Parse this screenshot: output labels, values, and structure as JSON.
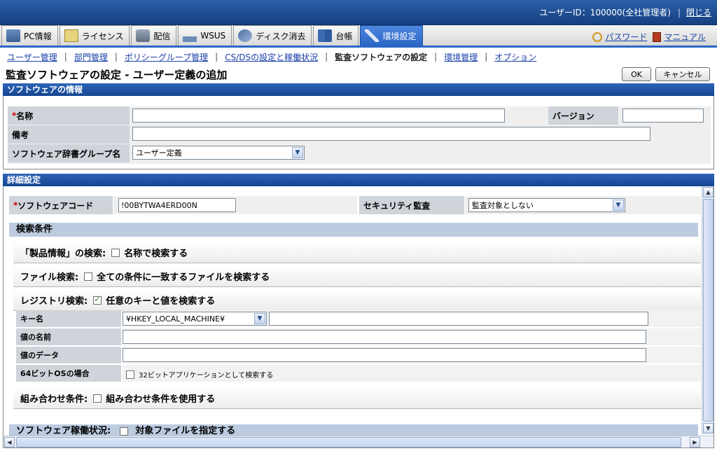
{
  "header": {
    "user_id": "ユーザーID：100000(全社管理者)",
    "sep": "|",
    "logout": "閉じる"
  },
  "tabs": [
    {
      "label": "PC情報",
      "icon": "pc-icon"
    },
    {
      "label": "ライセンス",
      "icon": "license-icon"
    },
    {
      "label": "配信",
      "icon": "distribution-icon"
    },
    {
      "label": "WSUS",
      "icon": "wsus-icon"
    },
    {
      "label": "ディスク消去",
      "icon": "disk-erase-icon"
    },
    {
      "label": "台帳",
      "icon": "ledger-icon"
    },
    {
      "label": "環境設定",
      "icon": "settings-tools-icon"
    }
  ],
  "toplinks": {
    "password": "パスワード",
    "manual": "マニュアル"
  },
  "subnav": {
    "user_mgmt": "ユーザー管理",
    "dept_mgmt": "部門管理",
    "policy_group": "ポリシーグループ管理",
    "cs_ds": "CS/DSの設定と稼働状況",
    "audit_sw": "監査ソフトウェアの設定",
    "env_mgmt": "環境管理",
    "option": "オプション",
    "bar": "|"
  },
  "page": {
    "title": "監査ソフトウェアの設定 - ユーザー定義の追加",
    "ok": "OK",
    "cancel": "キャンセル"
  },
  "software_info": {
    "heading": "ソフトウェアの情報",
    "req_mark": "*",
    "name_label": "名称",
    "name_value": "",
    "version_label": "バージョン",
    "version_value": "",
    "note_label": "備考",
    "note_value": "",
    "dict_group_label": "ソフトウェア辞書グループ名",
    "dict_group_value": "ユーザー定義"
  },
  "detail": {
    "heading": "詳細設定",
    "req_mark": "*",
    "sw_code_label": "ソフトウェアコード",
    "sw_code_value": "!00BYTWA4ERD00N",
    "security_label": "セキュリティ監査",
    "security_value": "監査対象としない",
    "search_cond": "検索条件",
    "product_search_label": "「製品情報」の検索:",
    "product_search_cb": "名称で検索する",
    "product_search_checked": false,
    "file_search_label": "ファイル検索:",
    "file_search_cb": "全ての条件に一致するファイルを検索する",
    "file_search_checked": false,
    "registry_label": "レジストリ検索:",
    "registry_cb": "任意のキーと値を検索する",
    "registry_checked": true,
    "key_name_label": "キー名",
    "key_root_value": "¥HKEY_LOCAL_MACHINE¥",
    "key_path_value": "",
    "value_name_label": "値の名前",
    "value_name_value": "",
    "value_data_label": "値のデータ",
    "value_data_value": "",
    "os64_label": "64ビットOSの場合",
    "os64_cb": "32ビットアプリケーションとして検索する",
    "os64_checked": false,
    "combo_label": "組み合わせ条件:",
    "combo_cb": "組み合わせ条件を使用する",
    "combo_checked": false,
    "operation_label": "ソフトウェア稼働状況:",
    "operation_cb": "対象ファイルを指定する",
    "operation_checked": false
  },
  "colors": {
    "accent": "#2c66c6",
    "header_bg": "#14407f",
    "label_bg": "#cfd4db"
  }
}
